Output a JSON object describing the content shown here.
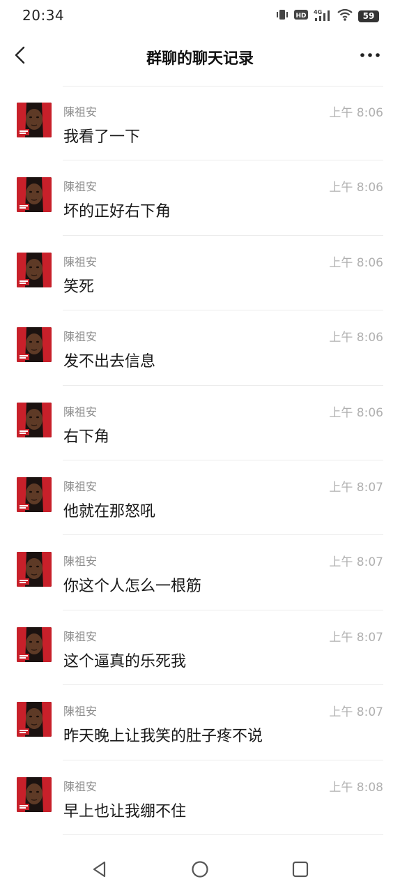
{
  "status_bar": {
    "time": "20:34",
    "hd_label": "HD",
    "network_label": "4G",
    "battery_level": "59"
  },
  "header": {
    "title": "群聊的聊天记录",
    "back_icon": "chevron-left-icon",
    "more_icon": "more-horizontal-icon"
  },
  "messages": [
    {
      "sender": "陳祖安",
      "time": "上午 8:06",
      "text": "我看了一下"
    },
    {
      "sender": "陳祖安",
      "time": "上午 8:06",
      "text": "坏的正好右下角"
    },
    {
      "sender": "陳祖安",
      "time": "上午 8:06",
      "text": "笑死"
    },
    {
      "sender": "陳祖安",
      "time": "上午 8:06",
      "text": "发不出去信息"
    },
    {
      "sender": "陳祖安",
      "time": "上午 8:06",
      "text": "右下角"
    },
    {
      "sender": "陳祖安",
      "time": "上午 8:07",
      "text": "他就在那怒吼"
    },
    {
      "sender": "陳祖安",
      "time": "上午 8:07",
      "text": "你这个人怎么一根筋"
    },
    {
      "sender": "陳祖安",
      "time": "上午 8:07",
      "text": "这个逼真的乐死我"
    },
    {
      "sender": "陳祖安",
      "time": "上午 8:07",
      "text": "昨天晚上让我笑的肚子疼不说"
    },
    {
      "sender": "陳祖安",
      "time": "上午 8:08",
      "text": "早上也让我绷不住"
    }
  ],
  "nav_bar": {
    "back_icon": "triangle-back-icon",
    "home_icon": "circle-home-icon",
    "recents_icon": "square-recents-icon"
  },
  "colors": {
    "accent_avatar_red": "#c8202a",
    "text_primary": "#191919",
    "text_secondary": "#8c8c8c",
    "timestamp": "#b0b0b0"
  }
}
